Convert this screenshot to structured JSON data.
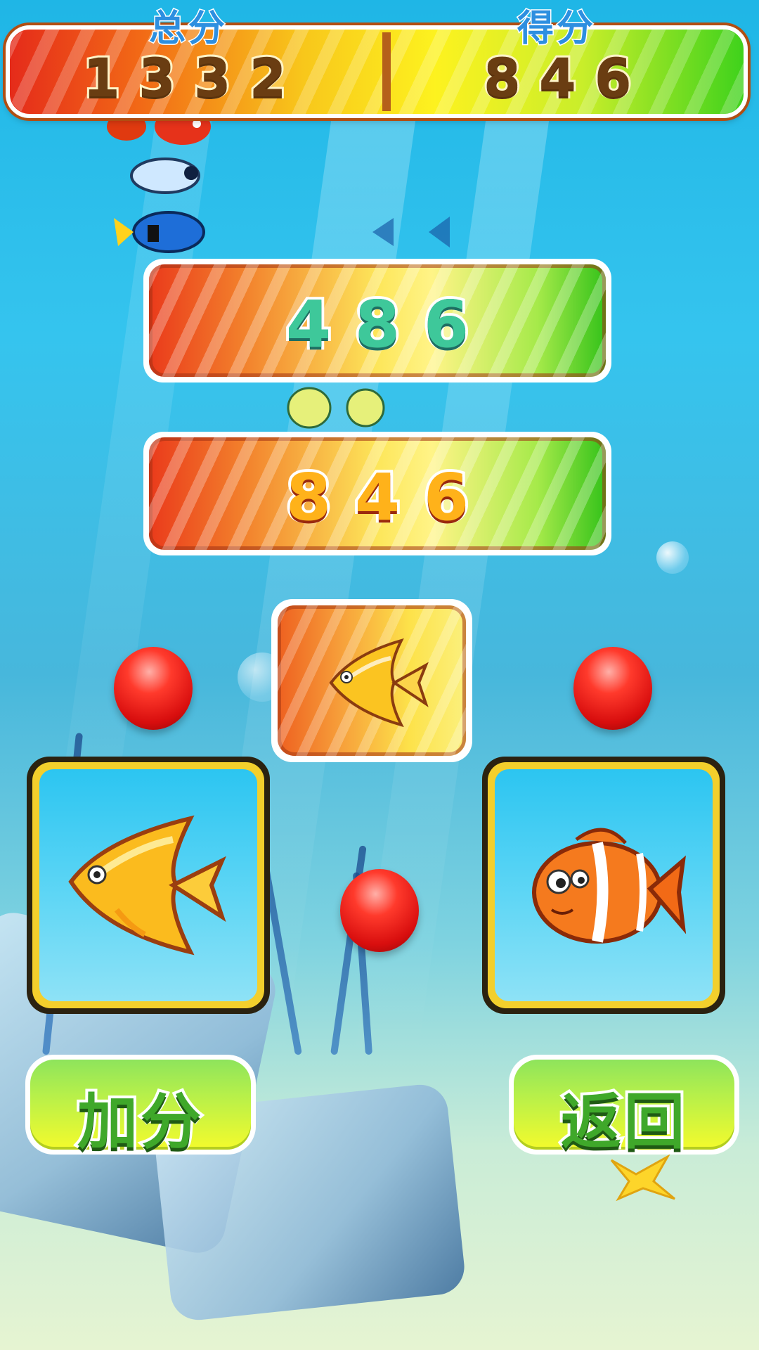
{
  "hud": {
    "total_label": "总分",
    "total_value": "1332",
    "score_label": "得分",
    "score_value": "846"
  },
  "panels": {
    "first_value": "486",
    "second_value": "846"
  },
  "target": {
    "icon": "angelfish-icon"
  },
  "cards": {
    "left": {
      "icon": "angelfish-icon"
    },
    "right": {
      "icon": "clownfish-icon"
    }
  },
  "buttons": {
    "add_points_label": "加分",
    "back_label": "返回"
  },
  "colors": {
    "ocean": "#2cc5f1",
    "ball_red": "#e01414",
    "button_green": "#8ee45c",
    "card_gold": "#f3cf2c"
  }
}
